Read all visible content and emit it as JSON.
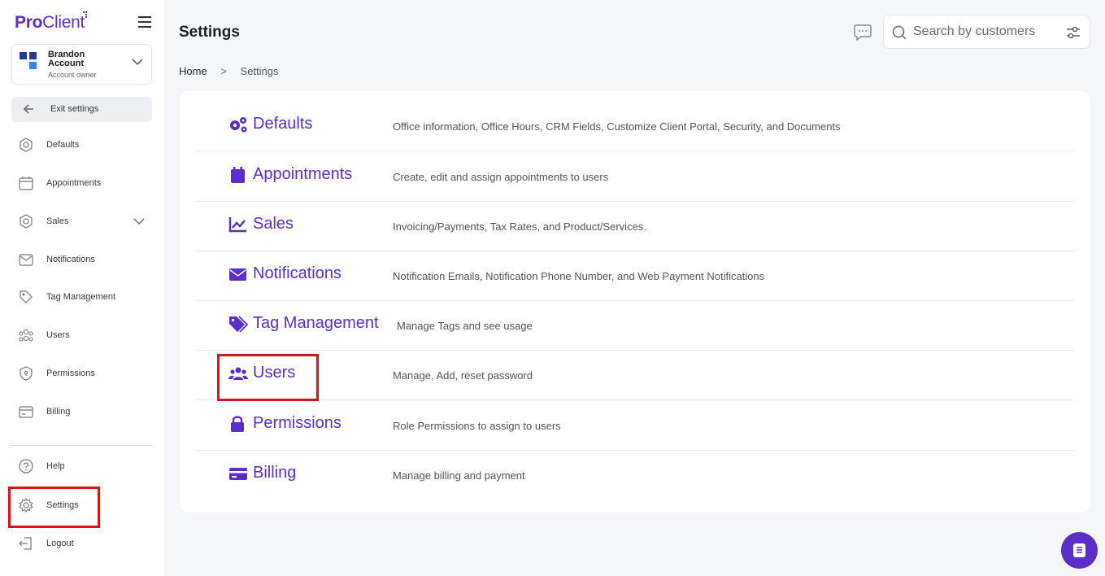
{
  "brand": {
    "logo_pro": "Pro",
    "logo_client": "Client",
    "accent": "#5b2fc7",
    "highlight": "#d9141a"
  },
  "account": {
    "name": "Brandon Account",
    "role": "Account owner"
  },
  "sidebar": {
    "exit_label": "Exit settings",
    "items": [
      {
        "label": "Defaults",
        "icon": "hexagon-gear-icon"
      },
      {
        "label": "Appointments",
        "icon": "calendar-icon"
      },
      {
        "label": "Sales",
        "icon": "hexagon-icon"
      },
      {
        "label": "Notifications",
        "icon": "envelope-icon"
      },
      {
        "label": "Tag Management",
        "icon": "tag-icon"
      },
      {
        "label": "Users",
        "icon": "users-icon"
      },
      {
        "label": "Permissions",
        "icon": "shield-icon"
      },
      {
        "label": "Billing",
        "icon": "card-icon"
      }
    ],
    "bottom": [
      {
        "label": "Help",
        "icon": "help-circle-icon"
      },
      {
        "label": "Settings",
        "icon": "gear-icon"
      },
      {
        "label": "Logout",
        "icon": "logout-icon"
      }
    ]
  },
  "header": {
    "title": "Settings",
    "search_placeholder": "Search by customers"
  },
  "breadcrumb": {
    "home": "Home",
    "sep": ">",
    "current": "Settings"
  },
  "settings": [
    {
      "title": "Defaults",
      "icon": "gears-icon",
      "desc": "Office information, Office Hours, CRM Fields, Customize Client Portal, Security, and Documents"
    },
    {
      "title": "Appointments",
      "icon": "calendar-icon",
      "desc": "Create, edit and assign appointments to users"
    },
    {
      "title": "Sales",
      "icon": "chart-line-icon",
      "desc": "Invoicing/Payments, Tax Rates, and Product/Services."
    },
    {
      "title": "Notifications",
      "icon": "envelope-icon",
      "desc": "Notification Emails, Notification Phone Number, and Web Payment Notifications"
    },
    {
      "title": "Tag Management",
      "icon": "tags-icon",
      "desc": "Manage Tags and see usage"
    },
    {
      "title": "Users",
      "icon": "users-icon",
      "desc": "Manage, Add, reset password"
    },
    {
      "title": "Permissions",
      "icon": "lock-icon",
      "desc": "Role Permissions to assign to users"
    },
    {
      "title": "Billing",
      "icon": "credit-card-icon",
      "desc": "Manage billing and payment"
    }
  ]
}
